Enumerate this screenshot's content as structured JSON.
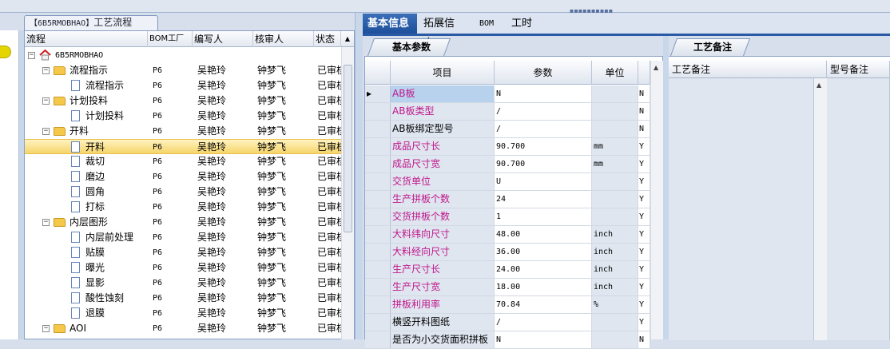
{
  "tree": {
    "tab_code": "【6B5RMOBHAO】",
    "tab_label": "工艺流程",
    "columns": [
      "流程",
      "BOM工厂",
      "编写人",
      "核审人",
      "状态"
    ],
    "scroll_up": "▲",
    "rows": [
      {
        "level": 0,
        "kind": "home",
        "exp": "−",
        "label": "6B5RMOBHAO",
        "bom": "",
        "author": "",
        "reviewer": "",
        "status": ""
      },
      {
        "level": 1,
        "kind": "folder",
        "exp": "−",
        "label": "流程指示",
        "bom": "P6",
        "author": "吴艳玲",
        "reviewer": "钟梦飞",
        "status": "已审核"
      },
      {
        "level": 2,
        "kind": "doc",
        "exp": "",
        "label": "流程指示",
        "bom": "P6",
        "author": "吴艳玲",
        "reviewer": "钟梦飞",
        "status": "已审核"
      },
      {
        "level": 1,
        "kind": "folder",
        "exp": "−",
        "label": "计划投料",
        "bom": "P6",
        "author": "吴艳玲",
        "reviewer": "钟梦飞",
        "status": "已审核"
      },
      {
        "level": 2,
        "kind": "doc",
        "exp": "",
        "label": "计划投料",
        "bom": "P6",
        "author": "吴艳玲",
        "reviewer": "钟梦飞",
        "status": "已审核"
      },
      {
        "level": 1,
        "kind": "folder",
        "exp": "−",
        "label": "开料",
        "bom": "P6",
        "author": "吴艳玲",
        "reviewer": "钟梦飞",
        "status": "已审核"
      },
      {
        "level": 2,
        "kind": "doc",
        "exp": "",
        "label": "开料",
        "bom": "P6",
        "author": "吴艳玲",
        "reviewer": "钟梦飞",
        "status": "已审核",
        "selected": true
      },
      {
        "level": 2,
        "kind": "doc",
        "exp": "",
        "label": "裁切",
        "bom": "P6",
        "author": "吴艳玲",
        "reviewer": "钟梦飞",
        "status": "已审核"
      },
      {
        "level": 2,
        "kind": "doc",
        "exp": "",
        "label": "磨边",
        "bom": "P6",
        "author": "吴艳玲",
        "reviewer": "钟梦飞",
        "status": "已审核"
      },
      {
        "level": 2,
        "kind": "doc",
        "exp": "",
        "label": "圆角",
        "bom": "P6",
        "author": "吴艳玲",
        "reviewer": "钟梦飞",
        "status": "已审核"
      },
      {
        "level": 2,
        "kind": "doc",
        "exp": "",
        "label": "打标",
        "bom": "P6",
        "author": "吴艳玲",
        "reviewer": "钟梦飞",
        "status": "已审核"
      },
      {
        "level": 1,
        "kind": "folder",
        "exp": "−",
        "label": "内层图形",
        "bom": "P6",
        "author": "吴艳玲",
        "reviewer": "钟梦飞",
        "status": "已审核"
      },
      {
        "level": 2,
        "kind": "doc",
        "exp": "",
        "label": "内层前处理",
        "bom": "P6",
        "author": "吴艳玲",
        "reviewer": "钟梦飞",
        "status": "已审核"
      },
      {
        "level": 2,
        "kind": "doc",
        "exp": "",
        "label": "贴膜",
        "bom": "P6",
        "author": "吴艳玲",
        "reviewer": "钟梦飞",
        "status": "已审核"
      },
      {
        "level": 2,
        "kind": "doc",
        "exp": "",
        "label": "曝光",
        "bom": "P6",
        "author": "吴艳玲",
        "reviewer": "钟梦飞",
        "status": "已审核"
      },
      {
        "level": 2,
        "kind": "doc",
        "exp": "",
        "label": "显影",
        "bom": "P6",
        "author": "吴艳玲",
        "reviewer": "钟梦飞",
        "status": "已审核"
      },
      {
        "level": 2,
        "kind": "doc",
        "exp": "",
        "label": "酸性蚀刻",
        "bom": "P6",
        "author": "吴艳玲",
        "reviewer": "钟梦飞",
        "status": "已审核"
      },
      {
        "level": 2,
        "kind": "doc",
        "exp": "",
        "label": "退膜",
        "bom": "P6",
        "author": "吴艳玲",
        "reviewer": "钟梦飞",
        "status": "已审核"
      },
      {
        "level": 1,
        "kind": "folder",
        "exp": "−",
        "label": "AOI",
        "bom": "P6",
        "author": "吴艳玲",
        "reviewer": "钟梦飞",
        "status": "已审核"
      }
    ]
  },
  "tabs": [
    {
      "label": "基本信息",
      "active": true
    },
    {
      "label": "拓展信息",
      "active": false
    },
    {
      "label": "BOM",
      "active": false
    },
    {
      "label": "工时",
      "active": false
    }
  ],
  "params": {
    "tab_label": "基本参数",
    "columns": [
      "项目",
      "参数",
      "单位"
    ],
    "current_marker": "▸",
    "scroll_up": "▲",
    "rows": [
      {
        "name": "AB板",
        "value": "N",
        "unit": "",
        "flag": "N",
        "pink": true,
        "selected": true
      },
      {
        "name": "AB板类型",
        "value": "/",
        "unit": "",
        "flag": "N",
        "pink": true
      },
      {
        "name": "AB板绑定型号",
        "value": "/",
        "unit": "",
        "flag": "N",
        "pink": false
      },
      {
        "name": "成品尺寸长",
        "value": "90.700",
        "unit": "mm",
        "flag": "Y",
        "pink": true
      },
      {
        "name": "成品尺寸宽",
        "value": "90.700",
        "unit": "mm",
        "flag": "Y",
        "pink": true
      },
      {
        "name": "交货单位",
        "value": "U",
        "unit": "",
        "flag": "Y",
        "pink": true
      },
      {
        "name": "生产拼板个数",
        "value": "24",
        "unit": "",
        "flag": "Y",
        "pink": true
      },
      {
        "name": "交货拼板个数",
        "value": "1",
        "unit": "",
        "flag": "Y",
        "pink": true
      },
      {
        "name": "大料纬向尺寸",
        "value": "48.00",
        "unit": "inch",
        "flag": "Y",
        "pink": true
      },
      {
        "name": "大料经向尺寸",
        "value": "36.00",
        "unit": "inch",
        "flag": "Y",
        "pink": true
      },
      {
        "name": "生产尺寸长",
        "value": "24.00",
        "unit": "inch",
        "flag": "Y",
        "pink": true
      },
      {
        "name": "生产尺寸宽",
        "value": "18.00",
        "unit": "inch",
        "flag": "Y",
        "pink": true
      },
      {
        "name": "拼板利用率",
        "value": "70.84",
        "unit": "%",
        "flag": "Y",
        "pink": true
      },
      {
        "name": "横竖开料图纸",
        "value": "/",
        "unit": "",
        "flag": "Y",
        "pink": false
      },
      {
        "name": "是否为小交货面积拼板",
        "value": "N",
        "unit": "",
        "flag": "N",
        "pink": false
      }
    ]
  },
  "remarks": {
    "tab_label": "工艺备注",
    "col1": "工艺备注",
    "col2": "型号备注",
    "scroll_up": "▲"
  },
  "colors": {
    "accent": "#2a5aa5",
    "pink_text": "#c0168a",
    "selection": "#f5d46a"
  }
}
